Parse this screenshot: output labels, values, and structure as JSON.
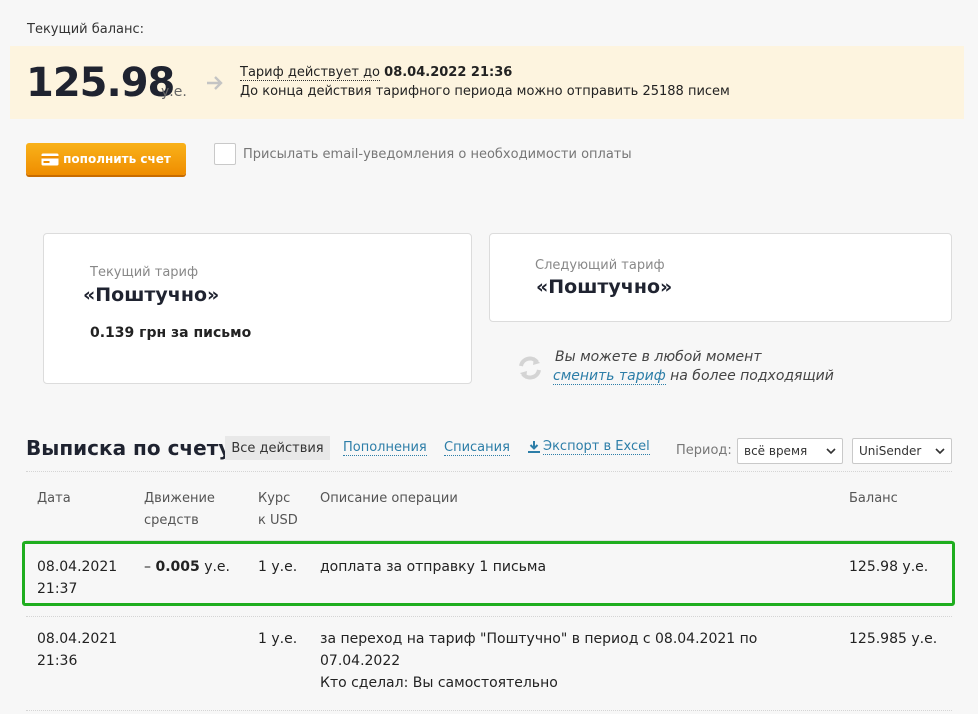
{
  "balance": {
    "label": "Текущий баланс:",
    "amount": "125.98",
    "unit": "у.е.",
    "tariff_until_prefix": "Тариф действует до",
    "tariff_until_date": "08.04.2022 21:36",
    "remaining_text": "До конца действия тарифного периода можно отправить 25188 писем"
  },
  "actions": {
    "topup_label": "пополнить счет",
    "notify_label": "Присылать email-уведомления о необходимости оплаты"
  },
  "tariffs": {
    "current_label": "Текущий тариф",
    "current_name": "«Поштучно»",
    "current_price": "0.139 грн за письмо",
    "next_label": "Следующий тариф",
    "next_name": "«Поштучно»",
    "change_line1": "Вы можете в любой момент",
    "change_link": "сменить тариф",
    "change_line2_rest": "на более подходящий"
  },
  "statement": {
    "title": "Выписка по счету",
    "tabs": {
      "all": "Все действия",
      "topups": "Пополнения",
      "debits": "Списания",
      "export": "Экспорт в Excel"
    },
    "period_label": "Период:",
    "period_value": "всё время",
    "account_value": "UniSender",
    "columns": {
      "date": "Дата",
      "movement_1": "Движение",
      "movement_2": "средств",
      "rate_1": "Курс",
      "rate_2": "к USD",
      "description": "Описание операции",
      "balance": "Баланс"
    },
    "rows": [
      {
        "date_1": "08.04.2021",
        "date_2": "21:37",
        "movement_prefix": "– ",
        "movement_value": "0.005",
        "movement_unit": " у.е.",
        "rate": "1 у.е.",
        "description_1": "доплата за отправку 1 письма",
        "balance": "125.98 у.е."
      },
      {
        "date_1": "08.04.2021",
        "date_2": "21:36",
        "rate": "1 у.е.",
        "description_1": "за переход на тариф \"Поштучно\" в период с 08.04.2021 по",
        "description_2": "07.04.2022",
        "description_3": "Кто сделал: Вы самостоятельно",
        "balance": "125.985 у.е."
      }
    ]
  },
  "colors": {
    "accent_orange": "#f5a00f",
    "link_blue": "#2d7ea8",
    "highlight_green": "#1fae1f",
    "balance_bg": "#fdf4df"
  }
}
